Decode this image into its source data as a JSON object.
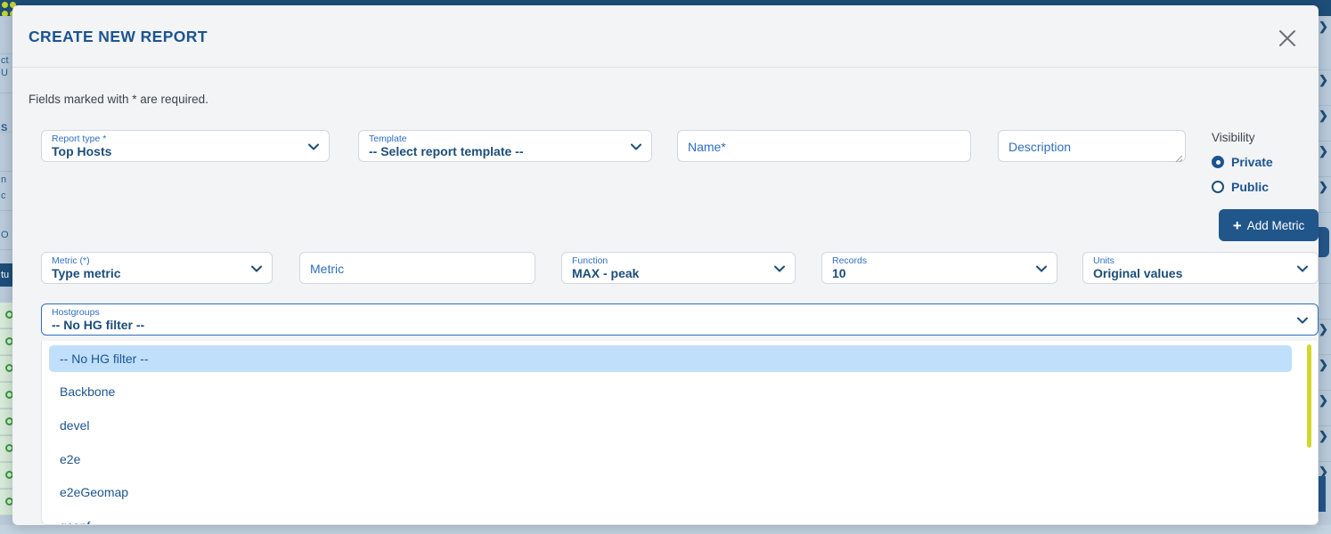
{
  "modal": {
    "title": "CREATE NEW REPORT",
    "close_icon": "close-icon",
    "required_note": "Fields marked with * are required."
  },
  "form": {
    "report_type": {
      "label": "Report type *",
      "value": "Top Hosts"
    },
    "template": {
      "label": "Template",
      "value": "-- Select report template --"
    },
    "name": {
      "placeholder": "Name*",
      "value": ""
    },
    "description": {
      "placeholder": "Description",
      "value": ""
    },
    "visibility": {
      "title": "Visibility",
      "options": [
        {
          "label": "Private",
          "checked": true
        },
        {
          "label": "Public",
          "checked": false
        }
      ]
    }
  },
  "metrics": {
    "add_button_label": "Add Metric",
    "add_button_icon": "plus-icon",
    "metric_type": {
      "label": "Metric (*)",
      "value": "Type metric"
    },
    "metric": {
      "placeholder": "Metric",
      "value": ""
    },
    "function": {
      "label": "Function",
      "value": "MAX - peak"
    },
    "records": {
      "label": "Records",
      "value": "10"
    },
    "units": {
      "label": "Units",
      "value": "Original values"
    }
  },
  "hostgroups": {
    "label": "Hostgroups",
    "value": "-- No HG filter --",
    "options": [
      {
        "label": "-- No HG filter --",
        "selected": true
      },
      {
        "label": "Backbone",
        "selected": false
      },
      {
        "label": "devel",
        "selected": false
      },
      {
        "label": "e2e",
        "selected": false
      },
      {
        "label": "e2eGeomap",
        "selected": false
      },
      {
        "label": "gconf",
        "selected": false
      }
    ]
  },
  "colors": {
    "brand_dark_blue": "#1d4e79",
    "accent_blue": "#2f6fbd",
    "button_blue": "#20568a",
    "selected_row": "#bfdffb",
    "scrollbar_thumb": "#d3d72c",
    "modal_bg": "#f2f4f6",
    "logo_yellow": "#c9d42e"
  },
  "background": {
    "sidebar_fragments": [
      "ct",
      "U",
      "S",
      "n",
      "c",
      "O",
      "tu"
    ]
  }
}
